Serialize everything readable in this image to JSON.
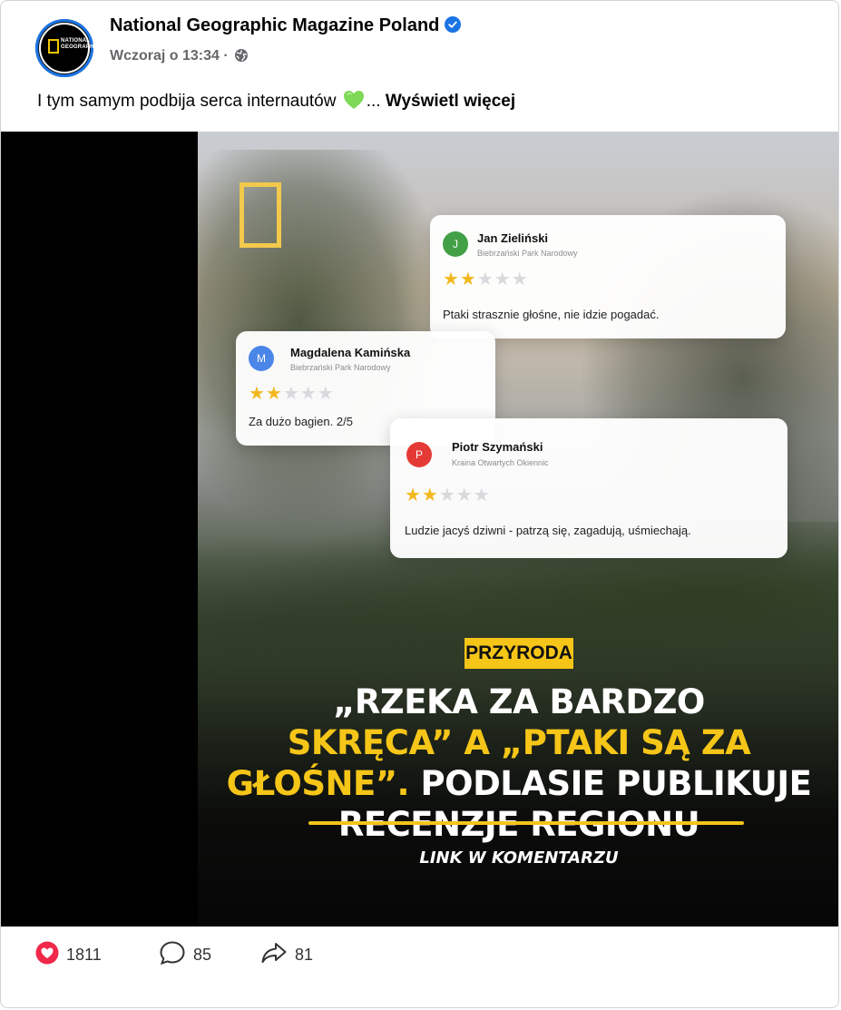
{
  "header": {
    "page_name": "National Geographic Magazine Poland",
    "timestamp": "Wczoraj o 13:34 ·",
    "verified_icon": "verified-badge-icon",
    "audience_icon": "globe-icon",
    "avatar_logo_text": "NATIONAL GEOGRAPHIC"
  },
  "post": {
    "caption": "I tym samym podbija serca internautów",
    "caption_emoji": "green-heart-icon",
    "caption_ellipsis": "...",
    "see_more": "Wyświetl więcej"
  },
  "media": {
    "reviews": [
      {
        "initial": "J",
        "name": "Jan Zieliński",
        "place": "Biebrzański Park Narodowy",
        "rating": 2,
        "max_rating": 5,
        "text": "Ptaki strasznie głośne, nie idzie pogadać.",
        "avatar_color": "#43a047"
      },
      {
        "initial": "M",
        "name": "Magdalena Kamińska",
        "place": "Biebrzański Park Narodowy",
        "rating": 2,
        "max_rating": 5,
        "text": "Za dużo bagien. 2/5",
        "avatar_color": "#4a86e8"
      },
      {
        "initial": "P",
        "name": "Piotr Szymański",
        "place": "Kraina Otwartych Okiennic",
        "rating": 2,
        "max_rating": 5,
        "text": "Ludzie jacyś dziwni - patrzą się, zagadują, uśmiechają.",
        "avatar_color": "#e53935"
      }
    ],
    "category": "PRZYRODA",
    "headline": {
      "part1": "„RZEKA ZA BARDZO",
      "part2_highlight": "SKRĘCA” A „PTAKI SĄ ZA",
      "part3_highlight": "GŁOŚNE”.",
      "part3_rest": "PODLASIE PUBLIKUJE",
      "part4": "RECENZJE REGIONU"
    },
    "link_text": "LINK W KOMENTARZU",
    "accent_color": "#f5c518"
  },
  "footer": {
    "reactions_count": "1811",
    "comments_count": "85",
    "shares_count": "81",
    "reaction_icon": "heart-reaction-icon",
    "comment_icon": "comment-icon",
    "share_icon": "share-icon"
  }
}
